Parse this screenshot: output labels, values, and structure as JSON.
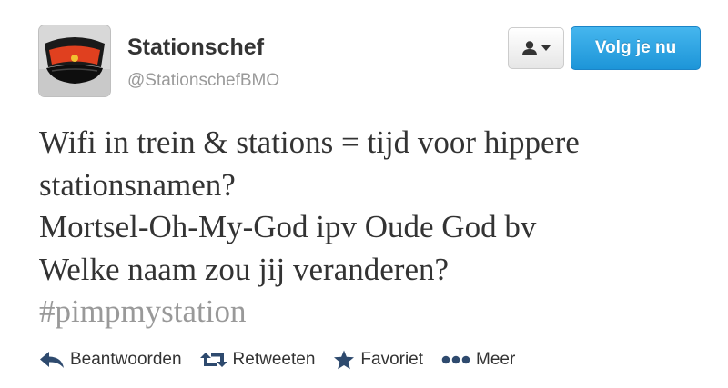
{
  "user": {
    "display_name": "Stationschef",
    "screen_name": "@StationschefBMO",
    "avatar_icon": "station-master-cap-icon"
  },
  "header": {
    "follow_label": "Volg je nu",
    "user_menu_icon": "user-dropdown-icon"
  },
  "tweet": {
    "lines": [
      "Wifi in trein & stations = tijd voor hippere",
      "stationsnamen?",
      "Mortsel-Oh-My-God ipv Oude God bv",
      "Welke naam zou jij veranderen?"
    ],
    "hashtag": "#pimpmystation"
  },
  "actions": {
    "reply_label": "Beantwoorden",
    "retweet_label": "Retweeten",
    "favorite_label": "Favoriet",
    "more_label": "Meer"
  },
  "colors": {
    "follow_button": "#2a9fe0",
    "hashtag": "#999999",
    "action_icon": "#2e4a6e"
  }
}
